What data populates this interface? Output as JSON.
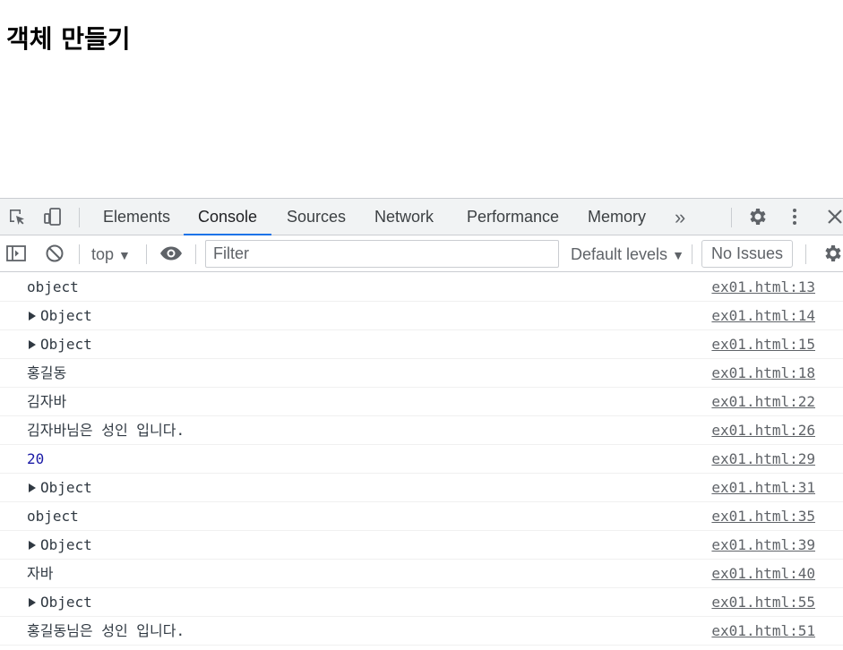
{
  "page": {
    "heading": "객체 만들기"
  },
  "devtools": {
    "tabs": [
      {
        "label": "Elements"
      },
      {
        "label": "Console"
      },
      {
        "label": "Sources"
      },
      {
        "label": "Network"
      },
      {
        "label": "Performance"
      },
      {
        "label": "Memory"
      }
    ],
    "active_tab": "Console",
    "more_tabs_label": "»",
    "toolbar": {
      "context": "top",
      "context_caret": "▼",
      "filter_placeholder": "Filter",
      "levels": "Default levels",
      "levels_caret": "▼",
      "issues": "No Issues"
    },
    "icons": {
      "inspect": "inspect-element-icon",
      "device": "device-toolbar-icon",
      "settings": "gear-icon",
      "menu": "kebab-menu-icon",
      "close": "close-icon",
      "sidebar": "console-sidebar-icon",
      "clear": "clear-console-icon",
      "live": "eye-icon"
    },
    "colors": {
      "accent": "#1a73e8",
      "number": "#1a1aa6",
      "text": "#303942",
      "link": "#5f6368"
    }
  },
  "console": {
    "messages": [
      {
        "text": "object",
        "source": "ex01.html:13"
      },
      {
        "text": "Object",
        "source": "ex01.html:14",
        "expandable": true
      },
      {
        "text": "Object",
        "source": "ex01.html:15",
        "expandable": true
      },
      {
        "text": "홍길동",
        "source": "ex01.html:18"
      },
      {
        "text": "김자바",
        "source": "ex01.html:22"
      },
      {
        "text": "김자바님은 성인 입니다.",
        "source": "ex01.html:26"
      },
      {
        "text": "20",
        "source": "ex01.html:29",
        "type": "number"
      },
      {
        "text": "Object",
        "source": "ex01.html:31",
        "expandable": true
      },
      {
        "text": "object",
        "source": "ex01.html:35"
      },
      {
        "text": "Object",
        "source": "ex01.html:39",
        "expandable": true
      },
      {
        "text": "자바",
        "source": "ex01.html:40"
      },
      {
        "text": "Object",
        "source": "ex01.html:55",
        "expandable": true
      },
      {
        "text": "홍길동님은 성인 입니다.",
        "source": "ex01.html:51"
      }
    ]
  }
}
